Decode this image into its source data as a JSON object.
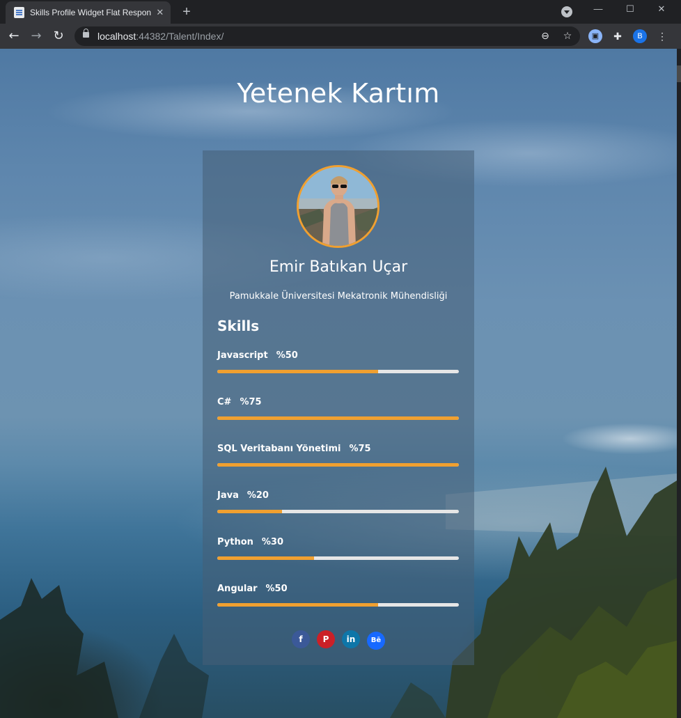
{
  "browser": {
    "tab_title": "Skills Profile Widget Flat Responsive",
    "url_host": "localhost",
    "url_rest": ":44382/Talent/Index/",
    "profile_initial": "B"
  },
  "page": {
    "title": "Yetenek Kartım"
  },
  "profile": {
    "name": "Emir Batıkan Uçar",
    "subtitle": "Pamukkale Üniversitesi Mekatronik Mühendisliği",
    "skills_heading": "Skills"
  },
  "skills": [
    {
      "name": "Javascript",
      "percent_label": "%50",
      "fill": 0.667
    },
    {
      "name": "C#",
      "percent_label": "%75",
      "fill": 1.0
    },
    {
      "name": "SQL Veritabanı Yönetimi",
      "percent_label": "%75",
      "fill": 1.0
    },
    {
      "name": "Java",
      "percent_label": "%20",
      "fill": 0.267
    },
    {
      "name": "Python",
      "percent_label": "%30",
      "fill": 0.4
    },
    {
      "name": "Angular",
      "percent_label": "%50",
      "fill": 0.667
    }
  ],
  "socials": [
    {
      "name": "facebook-icon",
      "glyph": "f",
      "color": "#3b5998"
    },
    {
      "name": "pinterest-icon",
      "glyph": "P",
      "color": "#cb2027"
    },
    {
      "name": "linkedin-icon",
      "glyph": "in",
      "color": "#0e76a8"
    },
    {
      "name": "behance-icon",
      "glyph": "Bē",
      "color": "#1769ff"
    }
  ],
  "colors": {
    "accent": "#f0a030",
    "track": "#e6e6e6"
  }
}
